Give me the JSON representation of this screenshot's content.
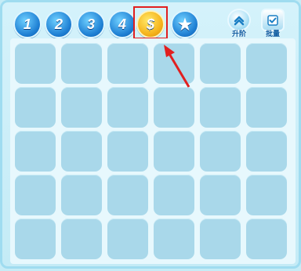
{
  "tabs": [
    {
      "label": "1",
      "icon": "number-1-icon"
    },
    {
      "label": "2",
      "icon": "number-2-icon"
    },
    {
      "label": "3",
      "icon": "number-3-icon"
    },
    {
      "label": "4",
      "icon": "number-4-icon"
    },
    {
      "label": "$",
      "icon": "gold-coin-icon",
      "selected": true
    },
    {
      "label": "★",
      "icon": "star-icon"
    }
  ],
  "actions": {
    "upgrade_label": "升阶",
    "batch_label": "批量"
  },
  "colors": {
    "highlight": "#e11f1f",
    "slot": "#a9d8ea",
    "panel": "#e7f8fd"
  },
  "grid": {
    "rows": 5,
    "cols": 6
  }
}
